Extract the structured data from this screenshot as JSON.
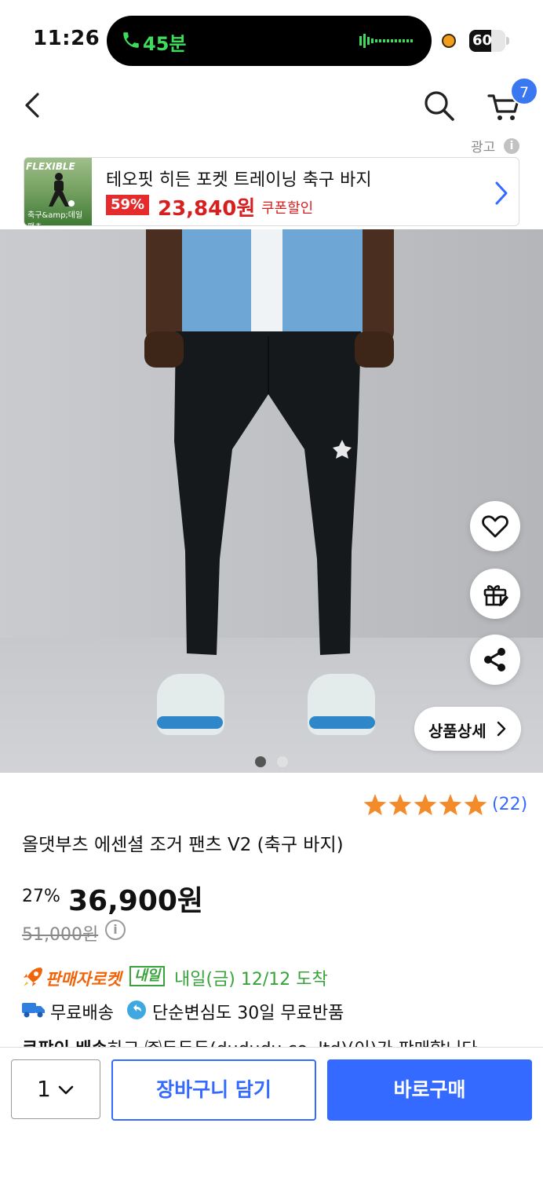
{
  "status_bar": {
    "time": "11:26",
    "call_duration": "45분",
    "battery": "60",
    "battery_level": 0.6
  },
  "header": {
    "cart_count": "7"
  },
  "ad": {
    "label": "광고",
    "thumb_title": "FLEXIBLE",
    "thumb_sub": "축구&amp;데일 팬츠",
    "title": "테오핏 히든 포켓 트레이닝 축구 바지",
    "discount": "59%",
    "price": "23,840원",
    "coupon": "쿠폰할인"
  },
  "hero": {
    "detail_button": "상품상세",
    "image_count": 2,
    "active_image": 1
  },
  "product": {
    "rating": 5,
    "review_count": "(22)",
    "title": "올댓부츠 에센셜 조거 팬츠 V2 (축구 바지)",
    "discount_rate": "27%",
    "sale_price": "36,900원",
    "original_price": "51,000원"
  },
  "delivery": {
    "rocket_label": "판매자로켓",
    "tomorrow_badge": "내일",
    "arrival": "내일(금) 12/12 도착",
    "free_shipping": "무료배송",
    "return_policy": "단순변심도 30일 무료반품",
    "seller_bold": "쿠팡이 배송",
    "seller_rest": "하고 ㈜두두두(dududu co.,ltd)(이)가 판매합니다"
  },
  "bottom_bar": {
    "quantity": "1",
    "add_to_cart": "장바구니 담기",
    "buy_now": "바로구매"
  },
  "colors": {
    "accent": "#346aff",
    "price_red": "#d81f1f",
    "rocket_orange": "#f0650a",
    "arrival_green": "#38a33a",
    "star": "#f58a2b"
  }
}
